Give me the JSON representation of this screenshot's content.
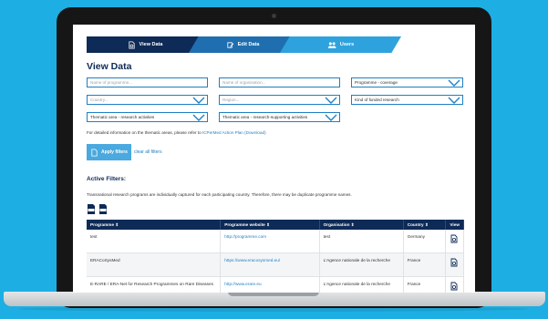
{
  "tabs": [
    {
      "label": "View Data",
      "icon": "view-data-icon"
    },
    {
      "label": "Edit Data",
      "icon": "edit-data-icon"
    },
    {
      "label": "Users",
      "icon": "users-icon"
    }
  ],
  "page_title": "View Data",
  "filters": {
    "programme_placeholder": "Name of programme...",
    "organisation_placeholder": "Name of organisation...",
    "coverage": "Programme - coverage",
    "country_placeholder": "Country...",
    "region_placeholder": "Region...",
    "kind_of_research": "Kind of funded research",
    "thematic_research": "Thematic area - research activities",
    "thematic_support": "Thematic area - research-supporting activities"
  },
  "note": {
    "text": "For detailed information on the thematic areas, please refer to ",
    "link": "ICPerMed Action Plan (Download)"
  },
  "apply_label": "Apply filters",
  "clear_label": "clear all filters",
  "active_filters_title": "Active Filters:",
  "transnational_note": "Transnational research programs are individually captured for each participating country. Therefore, there may be duplicate programme names.",
  "table": {
    "headers": [
      "Programme ⇕",
      "Programme website ⇕",
      "Organisation ⇕",
      "Country ⇕",
      "View"
    ],
    "rows": [
      {
        "programme": "test",
        "website": "http://programme.com",
        "organisation": "test",
        "country": "Germany"
      },
      {
        "programme": "ERACoSysMed",
        "website": "https://www.eracosysmed.eu/",
        "organisation": "L'Agence nationale de la recherche",
        "country": "France"
      },
      {
        "programme": "E-RARE / ERA-Net for Research Programmes on Rare Diseases",
        "website": "http://www.erare.eu",
        "organisation": "L'Agence nationale de la recherche",
        "country": "France"
      }
    ]
  },
  "colors": {
    "navy": "#0e2a56",
    "accent": "#1f7fc4",
    "background": "#1dafe3"
  }
}
